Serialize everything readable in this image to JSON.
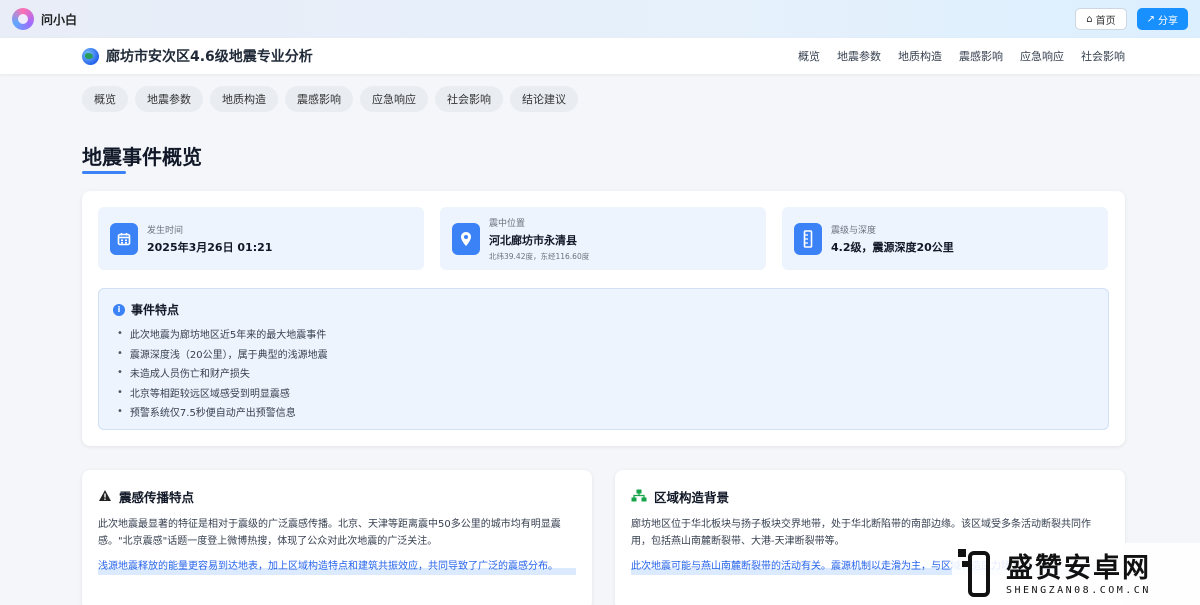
{
  "app": {
    "name": "问小白",
    "home_label": "首页",
    "share_label": "分享"
  },
  "header": {
    "title": "廊坊市安次区4.6级地震专业分析",
    "nav": [
      "概览",
      "地震参数",
      "地质构造",
      "震感影响",
      "应急响应",
      "社会影响"
    ]
  },
  "tabs": [
    "概览",
    "地震参数",
    "地质构造",
    "震感影响",
    "应急响应",
    "社会影响",
    "结论建议"
  ],
  "overview": {
    "title": "地震事件概览",
    "stats": [
      {
        "label": "发生时间",
        "value": "2025年3月26日 01:21",
        "icon": "calendar-icon"
      },
      {
        "label": "震中位置",
        "value": "河北廊坊市永清县",
        "sub": "北纬39.42度，东经116.60度",
        "icon": "map-pin-icon"
      },
      {
        "label": "震级与深度",
        "value": "4.2级，震源深度20公里",
        "icon": "ruler-icon"
      }
    ],
    "features": {
      "title": "事件特点",
      "items": [
        "此次地震为廊坊地区近5年来的最大地震事件",
        "震源深度浅（20公里），属于典型的浅源地震",
        "未造成人员伤亡和财产损失",
        "北京等相距较远区域感受到明显震感",
        "预警系统仅7.5秒便自动产出预警信息"
      ]
    }
  },
  "cards": [
    {
      "title": "震感传播特点",
      "icon": "warning-icon",
      "body": "此次地震最显著的特征是相对于震级的广泛震感传播。北京、天津等距离震中50多公里的城市均有明显震感。\"北京震感\"话题一度登上微博热搜，体现了公众对此次地震的广泛关注。",
      "highlight": "浅源地震释放的能量更容易到达地表，加上区域构造特点和建筑共振效应，共同导致了广泛的震感分布。"
    },
    {
      "title": "区域构造背景",
      "icon": "hierarchy-icon",
      "body": "廊坊地区位于华北板块与扬子板块交界地带，处于华北断陷带的南部边缘。该区域受多条活动断裂共同作用，包括燕山南麓断裂带、大港-天津断裂带等。",
      "highlight": "此次地震可能与燕山南麓断裂带的活动有关。震源机制以走滑为主，与区域构造应力场方向一致。"
    }
  ],
  "watermark": {
    "main": "盛赞安卓网",
    "sub": "SHENGZAN08.COM.CN"
  },
  "colors": {
    "accent": "#3b82f6",
    "share": "#1890ff",
    "panel": "#eef4fd"
  }
}
